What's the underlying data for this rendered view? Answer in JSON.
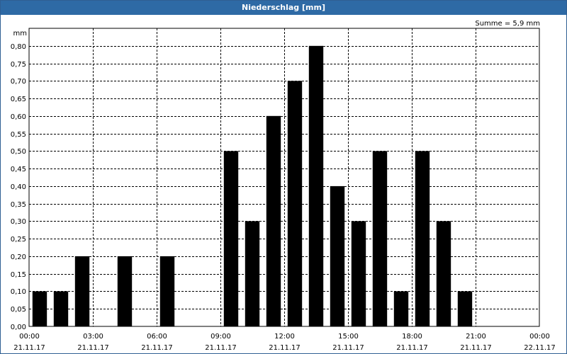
{
  "window": {
    "title": "Niederschlag [mm]"
  },
  "summary": "Summe = 5,9 mm",
  "chart_data": {
    "type": "bar",
    "title": "Niederschlag [mm]",
    "ylabel": "mm",
    "xlabel": "",
    "ylim": [
      0,
      0.85
    ],
    "grid": true,
    "bar_color": "#000000",
    "grid_color": "#000000",
    "y_ticks": [
      "0,00",
      "0,05",
      "0,10",
      "0,15",
      "0,20",
      "0,25",
      "0,30",
      "0,35",
      "0,40",
      "0,45",
      "0,50",
      "0,55",
      "0,60",
      "0,65",
      "0,70",
      "0,75",
      "0,80"
    ],
    "x_ticks": [
      {
        "time": "00:00",
        "date": "21.11.17"
      },
      {
        "time": "03:00",
        "date": "21.11.17"
      },
      {
        "time": "06:00",
        "date": "21.11.17"
      },
      {
        "time": "09:00",
        "date": "21.11.17"
      },
      {
        "time": "12:00",
        "date": "21.11.17"
      },
      {
        "time": "15:00",
        "date": "21.11.17"
      },
      {
        "time": "18:00",
        "date": "21.11.17"
      },
      {
        "time": "21:00",
        "date": "21.11.17"
      },
      {
        "time": "00:00",
        "date": "22.11.17"
      }
    ],
    "categories": [
      "00:00",
      "01:00",
      "02:00",
      "03:00",
      "04:00",
      "05:00",
      "06:00",
      "07:00",
      "08:00",
      "09:00",
      "10:00",
      "11:00",
      "12:00",
      "13:00",
      "14:00",
      "15:00",
      "16:00",
      "17:00",
      "18:00",
      "19:00",
      "20:00",
      "21:00",
      "22:00",
      "23:00"
    ],
    "values": [
      0.1,
      0.1,
      0.2,
      0,
      0.2,
      0,
      0.2,
      0,
      0,
      0.5,
      0.3,
      0.6,
      0.7,
      0.8,
      0.4,
      0.3,
      0.5,
      0.1,
      0.5,
      0.3,
      0.1,
      0,
      0,
      0
    ]
  }
}
